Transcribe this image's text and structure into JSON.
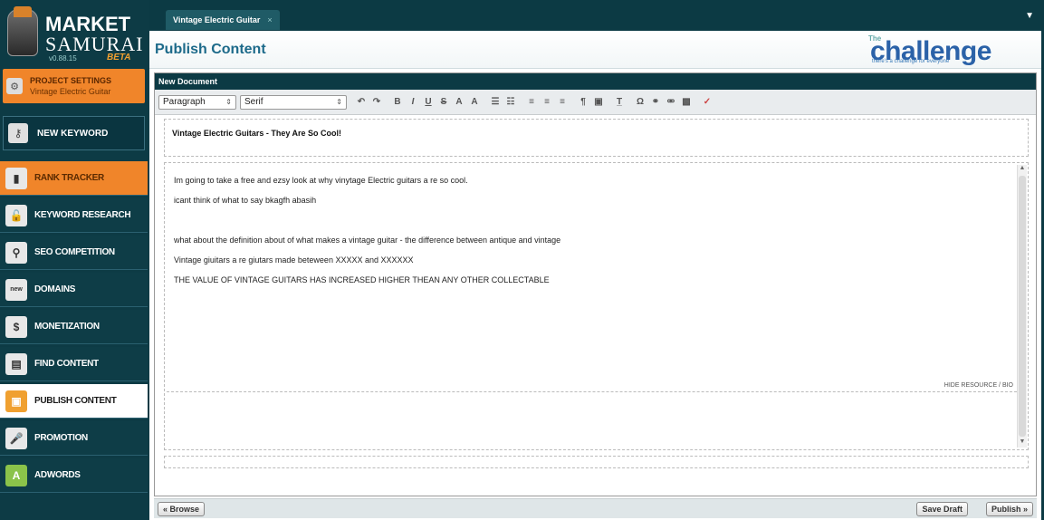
{
  "logo": {
    "brand_line1": "MARKET",
    "brand_line2": "SAMURAI",
    "version": "v0.88.15",
    "beta": "BETA"
  },
  "sidebar": {
    "project": {
      "title": "PROJECT SETTINGS",
      "subtitle": "Vintage Electric Guitar"
    },
    "new_keyword": "NEW KEYWORD",
    "items": [
      {
        "label": "RANK TRACKER",
        "icon": "bar-chart-icon"
      },
      {
        "label": "KEYWORD RESEARCH",
        "icon": "lock-icon"
      },
      {
        "label": "SEO COMPETITION",
        "icon": "magnifier-icon"
      },
      {
        "label": "DOMAINS",
        "icon": "new-badge-icon"
      },
      {
        "label": "MONETIZATION",
        "icon": "dollar-icon"
      },
      {
        "label": "FIND CONTENT",
        "icon": "document-icon"
      },
      {
        "label": "PUBLISH CONTENT",
        "icon": "publish-icon"
      },
      {
        "label": "PROMOTION",
        "icon": "microphone-icon"
      },
      {
        "label": "ADWORDS",
        "icon": "adwords-icon"
      }
    ]
  },
  "tabs": {
    "active": "Vintage Electric Guitar",
    "close": "×",
    "menu": "▼"
  },
  "header": {
    "page_title": "Publish Content",
    "logo_small": "The",
    "logo_big": "challenge",
    "logo_tag": "there's a challenge for everyone"
  },
  "editor": {
    "panel_title": "New Document",
    "format_select": "Paragraph",
    "font_select": "Serif",
    "doc_title": "Vintage Electric Guitars - They Are So Cool!",
    "body_lines": [
      "Im going to take a free and ezsy look at why vinytage Electric guitars a re so cool.",
      "icant think of what to say bkagfh abasih",
      "what about the definition about  of what makes a vintage guitar  - the difference between antique and vintage",
      "Vintage giuitars a re giutars made beteween  XXXXX and XXXXXX",
      "THE VALUE OF VINTAGE GUITARS HAS INCREASED HIGHER THEAN ANY OTHER COLLECTABLE"
    ],
    "hide_resource": "HIDE RESOURCE / BIO"
  },
  "footer": {
    "browse": "« Browse",
    "save_draft": "Save Draft",
    "publish": "Publish »"
  },
  "colors": {
    "sidebar_bg": "#0d3b45",
    "orange": "#f0852a",
    "title_blue": "#1d6a8a",
    "logo_blue": "#2b62a8"
  }
}
